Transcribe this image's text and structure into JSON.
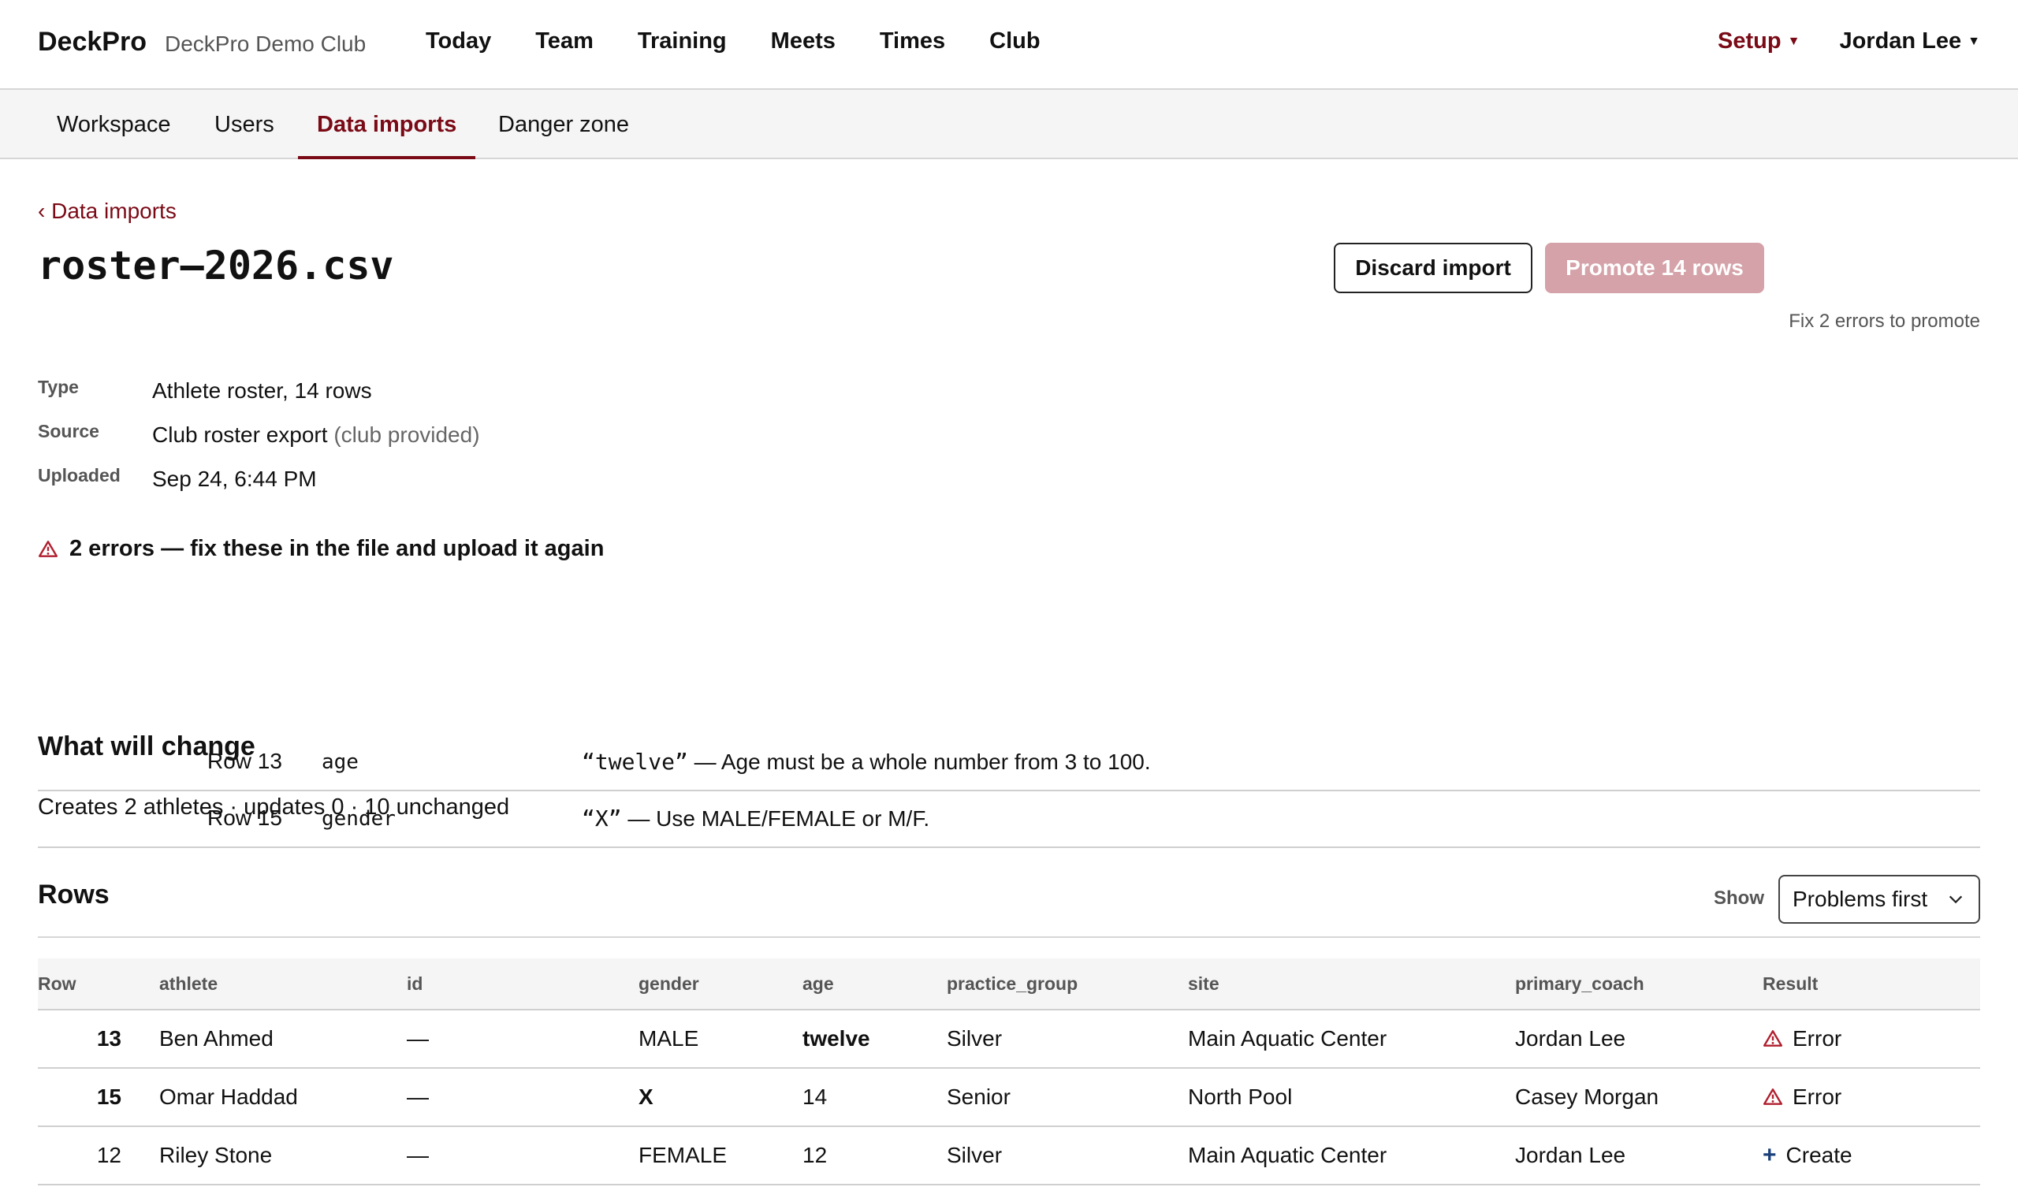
{
  "app": {
    "brand": "DeckPro",
    "club_name": "DeckPro Demo Club"
  },
  "nav": {
    "items": [
      "Today",
      "Team",
      "Training",
      "Meets",
      "Times",
      "Club"
    ],
    "setup": "Setup",
    "user": "Jordan Lee"
  },
  "subnav": {
    "tabs": [
      "Workspace",
      "Users",
      "Data imports",
      "Danger zone"
    ],
    "active": "Data imports"
  },
  "page": {
    "back_link": "‹ Data imports",
    "title": "roster–2026.csv",
    "discard_label": "Discard import",
    "promote_label": "Promote 14 rows",
    "promote_hint": "Fix 2 errors to promote"
  },
  "meta": {
    "type_label": "Type",
    "type_value": "Athlete roster, 14 rows",
    "source_label": "Source",
    "source_value": "Club roster export",
    "source_note": "(club provided)",
    "uploaded_label": "Uploaded",
    "uploaded_value": "Sep 24, 6:44 PM"
  },
  "errors": {
    "heading": "2 errors — fix these in the file and upload it again",
    "items": [
      {
        "row": "Row 13",
        "field": "age",
        "value": "“twelve”",
        "message": " — Age must be a whole number from 3 to 100."
      },
      {
        "row": "Row 15",
        "field": "gender",
        "value": "“X”",
        "message": " — Use MALE/FEMALE or M/F."
      }
    ]
  },
  "changes": {
    "title": "What will change",
    "summary": "Creates 2 athletes · updates 0 · 10 unchanged"
  },
  "rows_section": {
    "title": "Rows",
    "show_label": "Show",
    "show_value": "Problems first",
    "columns": [
      "Row",
      "athlete",
      "id",
      "gender",
      "age",
      "practice_group",
      "site",
      "primary_coach",
      "Result"
    ],
    "rows": [
      {
        "row": "13",
        "athlete": "Ben Ahmed",
        "id": "—",
        "gender": "MALE",
        "age": "twelve",
        "practice_group": "Silver",
        "site": "Main Aquatic Center",
        "primary_coach": "Jordan Lee",
        "result": "Error"
      },
      {
        "row": "15",
        "athlete": "Omar Haddad",
        "id": "—",
        "gender": "X",
        "age": "14",
        "practice_group": "Senior",
        "site": "North Pool",
        "primary_coach": "Casey Morgan",
        "result": "Error"
      },
      {
        "row": "12",
        "athlete": "Riley Stone",
        "id": "—",
        "gender": "FEMALE",
        "age": "12",
        "practice_group": "Silver",
        "site": "Main Aquatic Center",
        "primary_coach": "Jordan Lee",
        "result": "Create"
      }
    ]
  },
  "colors": {
    "accent": "#7a0a16",
    "error": "#b01e2e",
    "promote_disabled": "#d4a2a8",
    "create_icon": "#1a3f7a"
  },
  "icons": {
    "warning": "warning-triangle-icon",
    "create": "plus-icon",
    "caret": "caret-down-icon",
    "select_chevron": "chevron-down-icon"
  }
}
